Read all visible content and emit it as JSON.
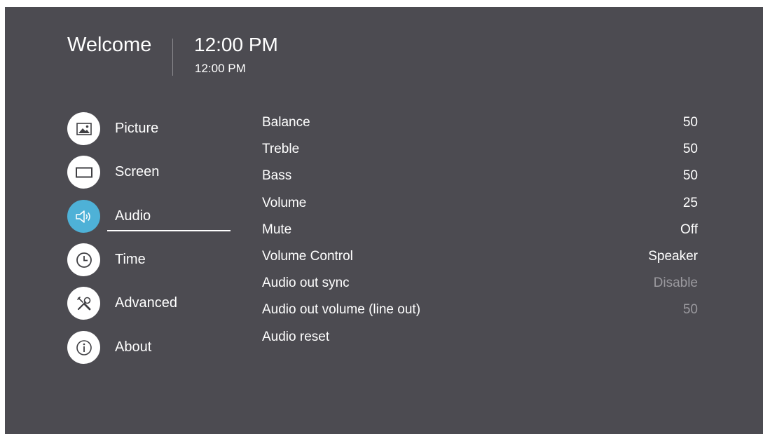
{
  "header": {
    "welcome": "Welcome",
    "time_large": "12:00 PM",
    "time_small": "12:00 PM"
  },
  "nav": [
    {
      "label": "Picture",
      "icon": "picture-icon",
      "active": false
    },
    {
      "label": "Screen",
      "icon": "screen-icon",
      "active": false
    },
    {
      "label": "Audio",
      "icon": "speaker-icon",
      "active": true
    },
    {
      "label": "Time",
      "icon": "clock-icon",
      "active": false
    },
    {
      "label": "Advanced",
      "icon": "tools-icon",
      "active": false
    },
    {
      "label": "About",
      "icon": "info-icon",
      "active": false
    }
  ],
  "settings": [
    {
      "label": "Balance",
      "value": "50",
      "enabled": true
    },
    {
      "label": "Treble",
      "value": "50",
      "enabled": true
    },
    {
      "label": "Bass",
      "value": "50",
      "enabled": true
    },
    {
      "label": "Volume",
      "value": "25",
      "enabled": true
    },
    {
      "label": "Mute",
      "value": "Off",
      "enabled": true
    },
    {
      "label": "Volume Control",
      "value": "Speaker",
      "enabled": true
    },
    {
      "label": "Audio out sync",
      "value": "Disable",
      "enabled": false
    },
    {
      "label": "Audio out volume (line out)",
      "value": "50",
      "enabled": false
    },
    {
      "label": "Audio reset",
      "value": "",
      "enabled": true
    }
  ],
  "colors": {
    "background": "#4c4b51",
    "accent": "#4eb1d7",
    "text": "#ffffff",
    "disabled_text": "#9b9a9f"
  }
}
